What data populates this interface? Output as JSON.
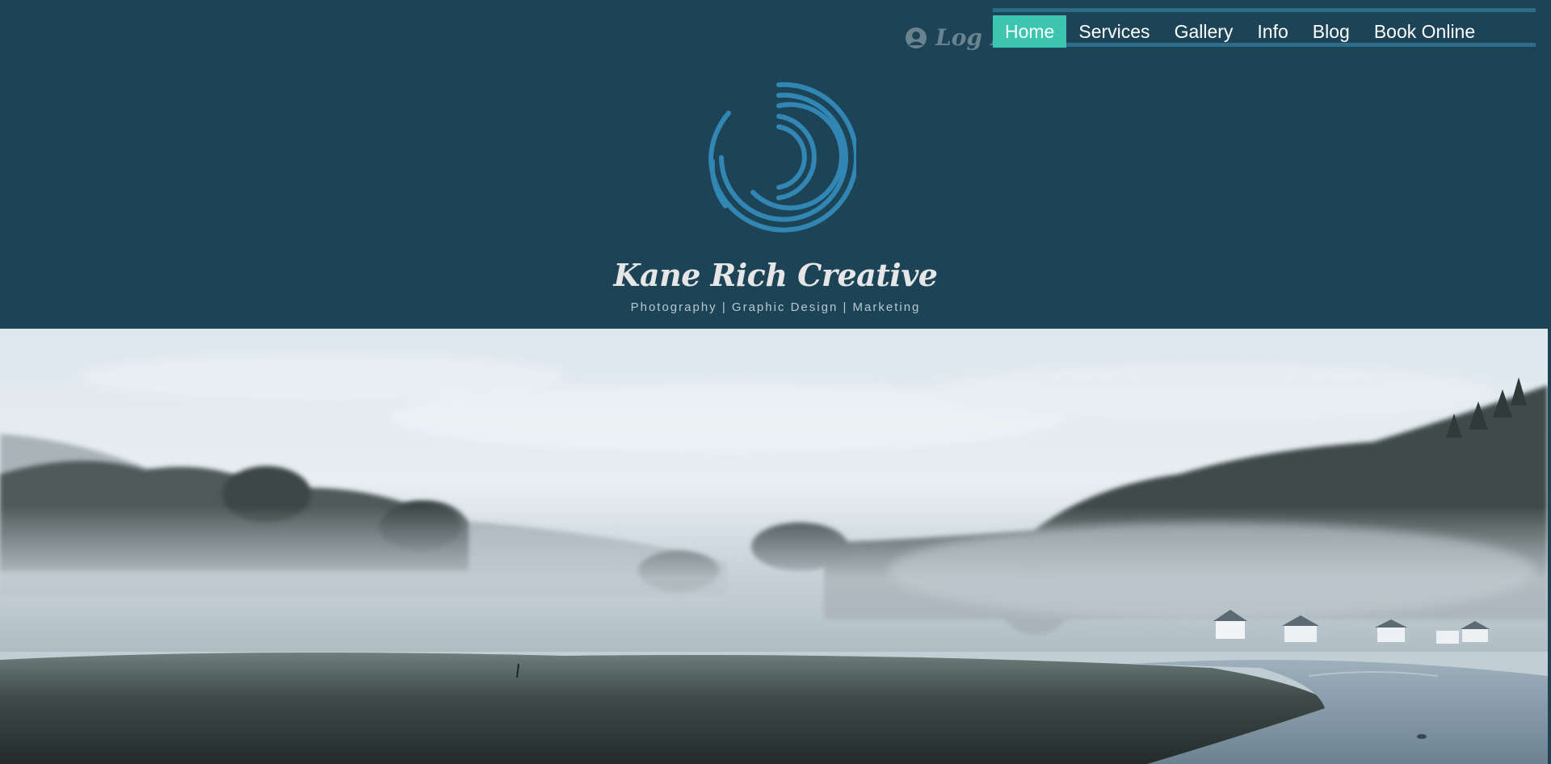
{
  "header": {
    "login_label": "Log In",
    "brand_title": "Kane Rich Creative",
    "tagline": "Photography | Graphic Design | Marketing"
  },
  "nav": {
    "items": [
      {
        "label": "Home",
        "active": true
      },
      {
        "label": "Services",
        "active": false
      },
      {
        "label": "Gallery",
        "active": false
      },
      {
        "label": "Info",
        "active": false
      },
      {
        "label": "Blog",
        "active": false
      },
      {
        "label": "Book Online",
        "active": false
      }
    ]
  },
  "icons": {
    "login": "user-circle-icon",
    "logo": "concentric-arcs-logo"
  },
  "colors": {
    "header_bg": "#1c4456",
    "nav_active": "#3cc6b1",
    "nav_border": "#2e6d8a",
    "logo": "#3286b4"
  }
}
